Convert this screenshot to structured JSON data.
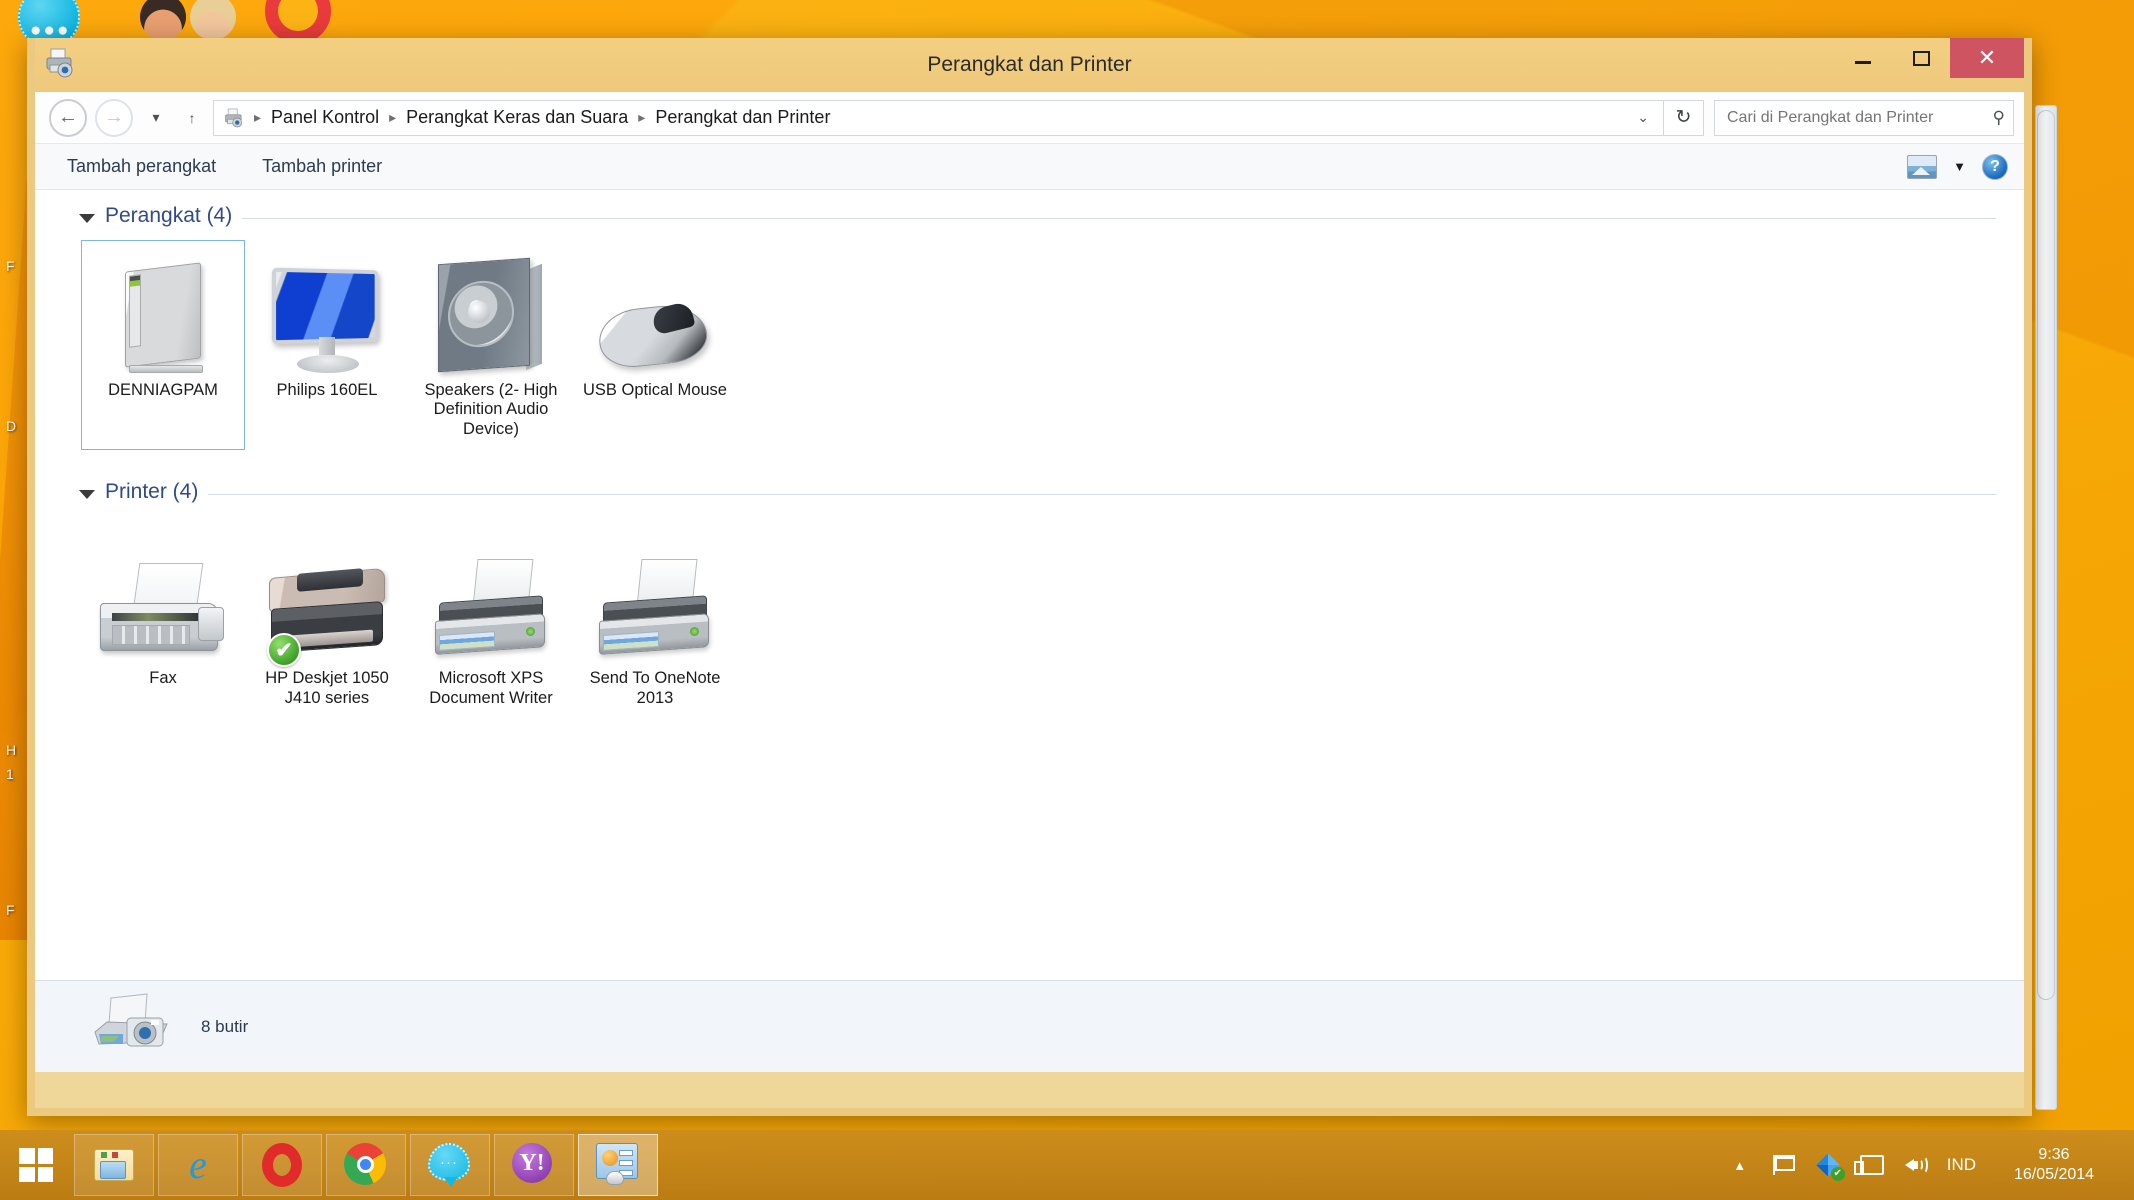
{
  "window": {
    "title": "Perangkat dan Printer",
    "title_icon": "devices-and-printers-icon",
    "controls": {
      "minimize": "–",
      "maximize": "❑",
      "close": "✕"
    }
  },
  "navigation": {
    "back": "←",
    "forward": "→",
    "recent_caret": "▾",
    "up": "↑",
    "breadcrumb_icon": "devices-and-printers-icon",
    "breadcrumb": [
      "Panel Kontrol",
      "Perangkat Keras dan Suara",
      "Perangkat dan Printer"
    ],
    "separator": "▸",
    "address_caret": "⌄",
    "refresh": "↻"
  },
  "search": {
    "placeholder": "Cari di Perangkat dan Printer",
    "value": "",
    "icon": "search-icon"
  },
  "commandbar": {
    "add_device": "Tambah perangkat",
    "add_printer": "Tambah printer",
    "preview_icon": "preview-pane-icon",
    "preview_caret": "▼",
    "help_icon": "help-icon",
    "help_glyph": "?"
  },
  "groups": [
    {
      "caret": "◢",
      "title": "Perangkat (4)",
      "items": [
        {
          "label": "DENNIAGPAM",
          "icon": "computer-tower-icon",
          "selected": true,
          "default_badge": false
        },
        {
          "label": "Philips 160EL",
          "icon": "monitor-icon",
          "selected": false,
          "default_badge": false
        },
        {
          "label": "Speakers (2- High Definition Audio Device)",
          "icon": "speaker-icon",
          "selected": false,
          "default_badge": false
        },
        {
          "label": "USB Optical Mouse",
          "icon": "mouse-icon",
          "selected": false,
          "default_badge": false
        }
      ]
    },
    {
      "caret": "◢",
      "title": "Printer (4)",
      "items": [
        {
          "label": "Fax",
          "icon": "fax-icon",
          "selected": false,
          "default_badge": false
        },
        {
          "label": "HP Deskjet 1050 J410 series",
          "icon": "deskjet-printer-icon",
          "selected": false,
          "default_badge": true,
          "badge_glyph": "✔"
        },
        {
          "label": "Microsoft XPS Document Writer",
          "icon": "printer-icon",
          "selected": false,
          "default_badge": false
        },
        {
          "label": "Send To OneNote 2013",
          "icon": "printer-icon",
          "selected": false,
          "default_badge": false
        }
      ]
    }
  ],
  "statusbar": {
    "icon": "printer-camera-icon",
    "text": "8 butir"
  },
  "desktop": {
    "partial_icons": [
      "chat-bubble-icon",
      "avatar-dark-icon",
      "avatar-light-icon",
      "opera-icon"
    ],
    "bubble_dots": "●●●",
    "edge_labels": [
      "F",
      "D",
      "H",
      "1",
      "F"
    ]
  },
  "taskbar": {
    "start": "start-button",
    "buttons": [
      {
        "name": "file-explorer",
        "icon": "file-explorer-icon",
        "active": false
      },
      {
        "name": "internet-explorer",
        "icon": "internet-explorer-icon",
        "glyph": "e",
        "active": false
      },
      {
        "name": "opera",
        "icon": "opera-icon",
        "active": false
      },
      {
        "name": "google-chrome",
        "icon": "chrome-icon",
        "active": false
      },
      {
        "name": "messenger",
        "icon": "chat-bubble-icon",
        "glyph": "···",
        "active": false
      },
      {
        "name": "yahoo-messenger",
        "icon": "yahoo-icon",
        "glyph": "Y!",
        "active": false
      },
      {
        "name": "devices-and-printers",
        "icon": "devices-and-printers-icon",
        "active": true
      }
    ],
    "tray": {
      "show_hidden": "▲",
      "action_center": "flag-icon",
      "dropbox": "dropbox-icon",
      "dropbox_check": "✔",
      "network": "network-icon",
      "volume": "volume-icon",
      "language": "IND",
      "time": "9:36",
      "date": "16/05/2014"
    }
  },
  "colors": {
    "window_frame": "#eec97c",
    "close_button": "#cf5462",
    "group_title": "#2f4a8a",
    "selection_border": "#7eb4ea",
    "desktop": "#fcb415"
  }
}
